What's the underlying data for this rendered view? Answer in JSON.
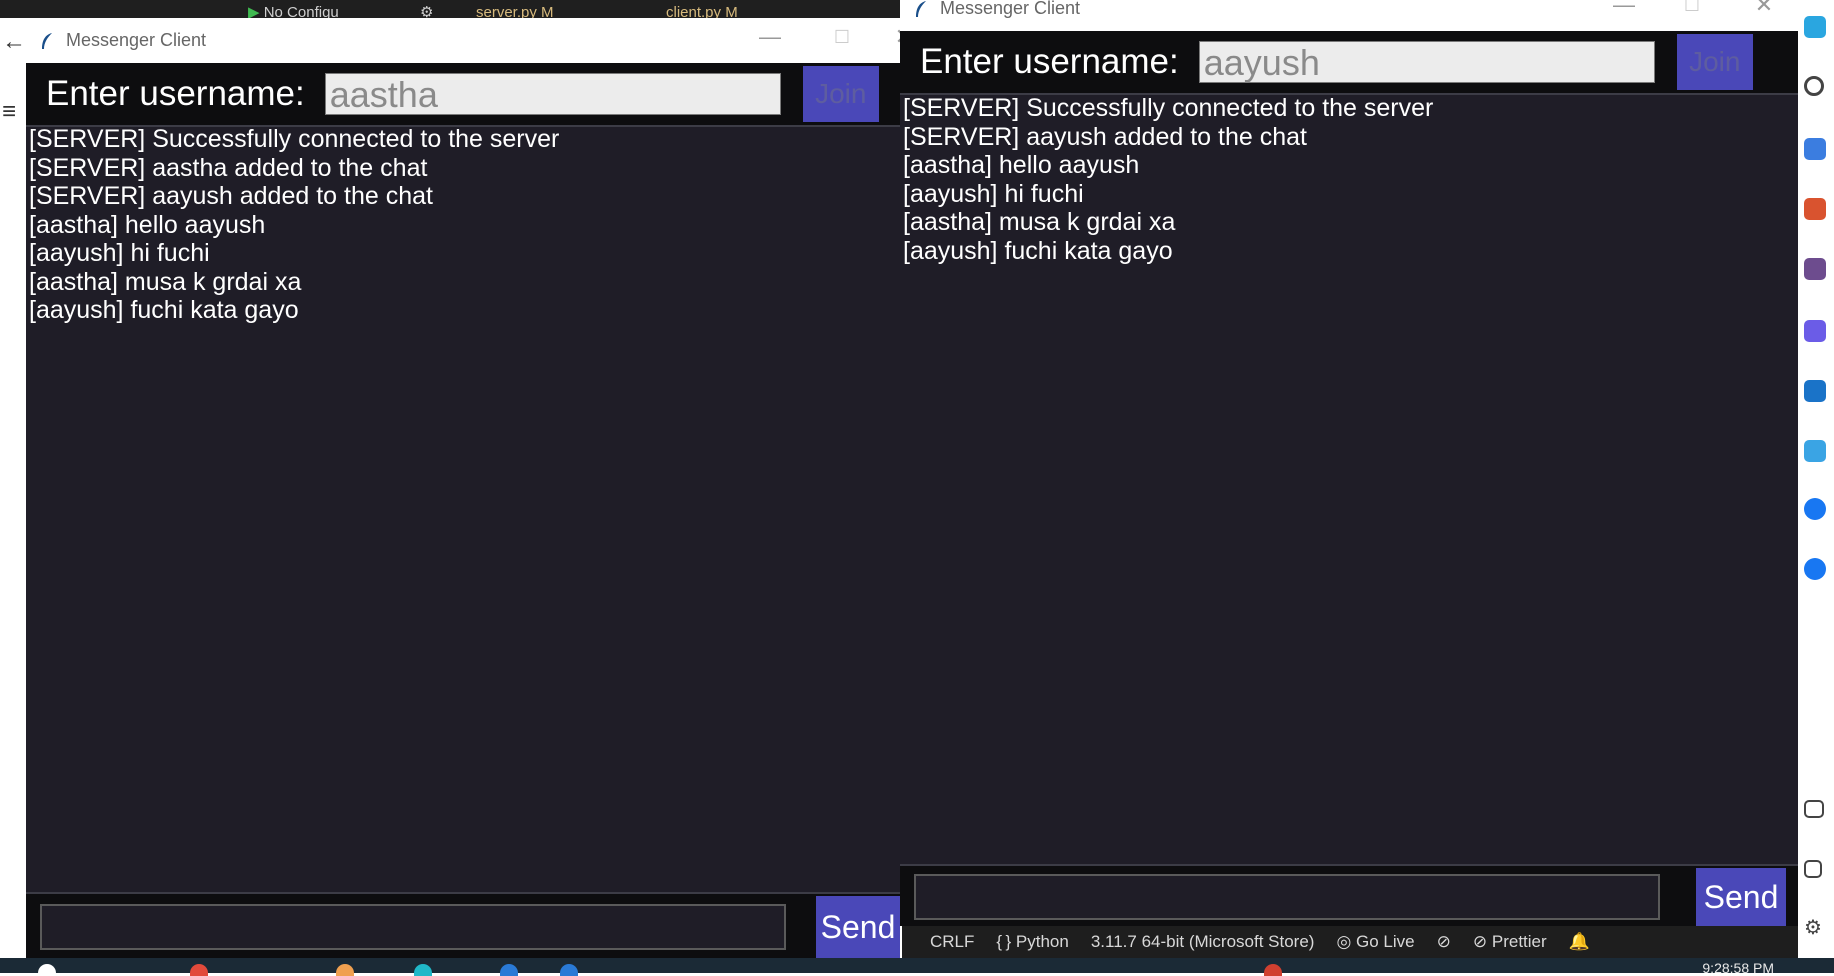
{
  "desktop": {
    "ide_tabs": [
      "No Configu",
      "server.py M",
      "client.py M"
    ],
    "status_bar": {
      "line_ending": "CRLF",
      "language": "Python",
      "interpreter": "3.11.7 64-bit (Microsoft Store)",
      "go_live": "Go Live",
      "prettier": "Prettier"
    },
    "clock": "9:28:58 PM"
  },
  "windows": [
    {
      "title": "Messenger Client",
      "username_label": "Enter username:",
      "username_value": "aastha",
      "join_label": "Join",
      "send_label": "Send",
      "messages": [
        "[SERVER] Successfully connected to the server",
        "[SERVER] aastha added to the chat",
        "[SERVER] aayush added to the chat",
        "[aastha] hello aayush",
        "[aayush] hi fuchi",
        "[aastha] musa k grdai xa",
        "[aayush] fuchi kata gayo"
      ]
    },
    {
      "title": "Messenger Client",
      "username_label": "Enter username:",
      "username_value": "aayush",
      "join_label": "Join",
      "send_label": "Send",
      "messages": [
        "[SERVER] Successfully connected to the server",
        "[SERVER] aayush added to the chat",
        "[aastha] hello aayush",
        "[aayush] hi fuchi",
        "[aastha] musa k grdai xa",
        "[aayush] fuchi kata gayo"
      ]
    }
  ],
  "colors": {
    "accent": "#4a48b8",
    "chat_bg": "#1f1d27",
    "header_bg": "#0d0d0f"
  }
}
